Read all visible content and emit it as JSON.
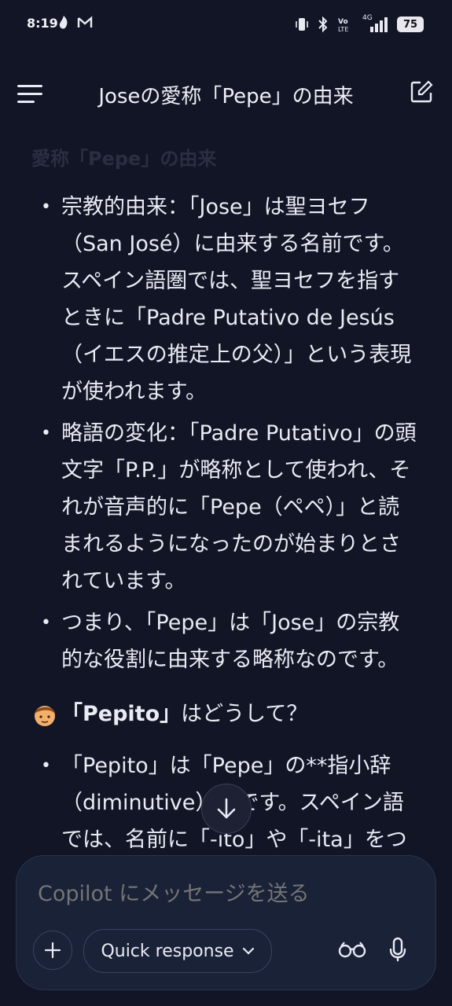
{
  "status_bar": {
    "time": "8:19",
    "battery": "75",
    "network": "4G"
  },
  "header": {
    "title": "Joseの愛称「Pepe」の由来"
  },
  "faded_heading": "愛称「Pepe」の由来",
  "message": {
    "bullets": [
      "宗教的由来：「Jose」は聖ヨセフ（San José）に由来する名前です。スペイン語圏では、聖ヨセフを指すときに「Padre Putativo de Jesús（イエスの推定上の父）」という表現が使われます。",
      "略語の変化：「Padre Putativo」の頭文字「P.P.」が略称として使われ、それが音声的に「Pepe（ペペ）」と読まれるようになったのが始まりとされています。",
      "つまり、「Pepe」は「Jose」の宗教的な役割に由来する略称なのです。"
    ],
    "user_question_bold": "「Pepito」",
    "user_question_rest": "はどうして？",
    "bullets2": [
      "「Pepito」は「Pepe」の**指小辞（diminutive）**です。スペイン語では、名前に「-ito」や「-ita」をつける"
    ]
  },
  "composer": {
    "placeholder": "Copilot にメッセージを送る",
    "mode_label": "Quick response"
  },
  "colors": {
    "background": "#111526",
    "composer_bg": "#1a2238",
    "text": "#e9ebf3",
    "placeholder": "#8b92b3"
  }
}
